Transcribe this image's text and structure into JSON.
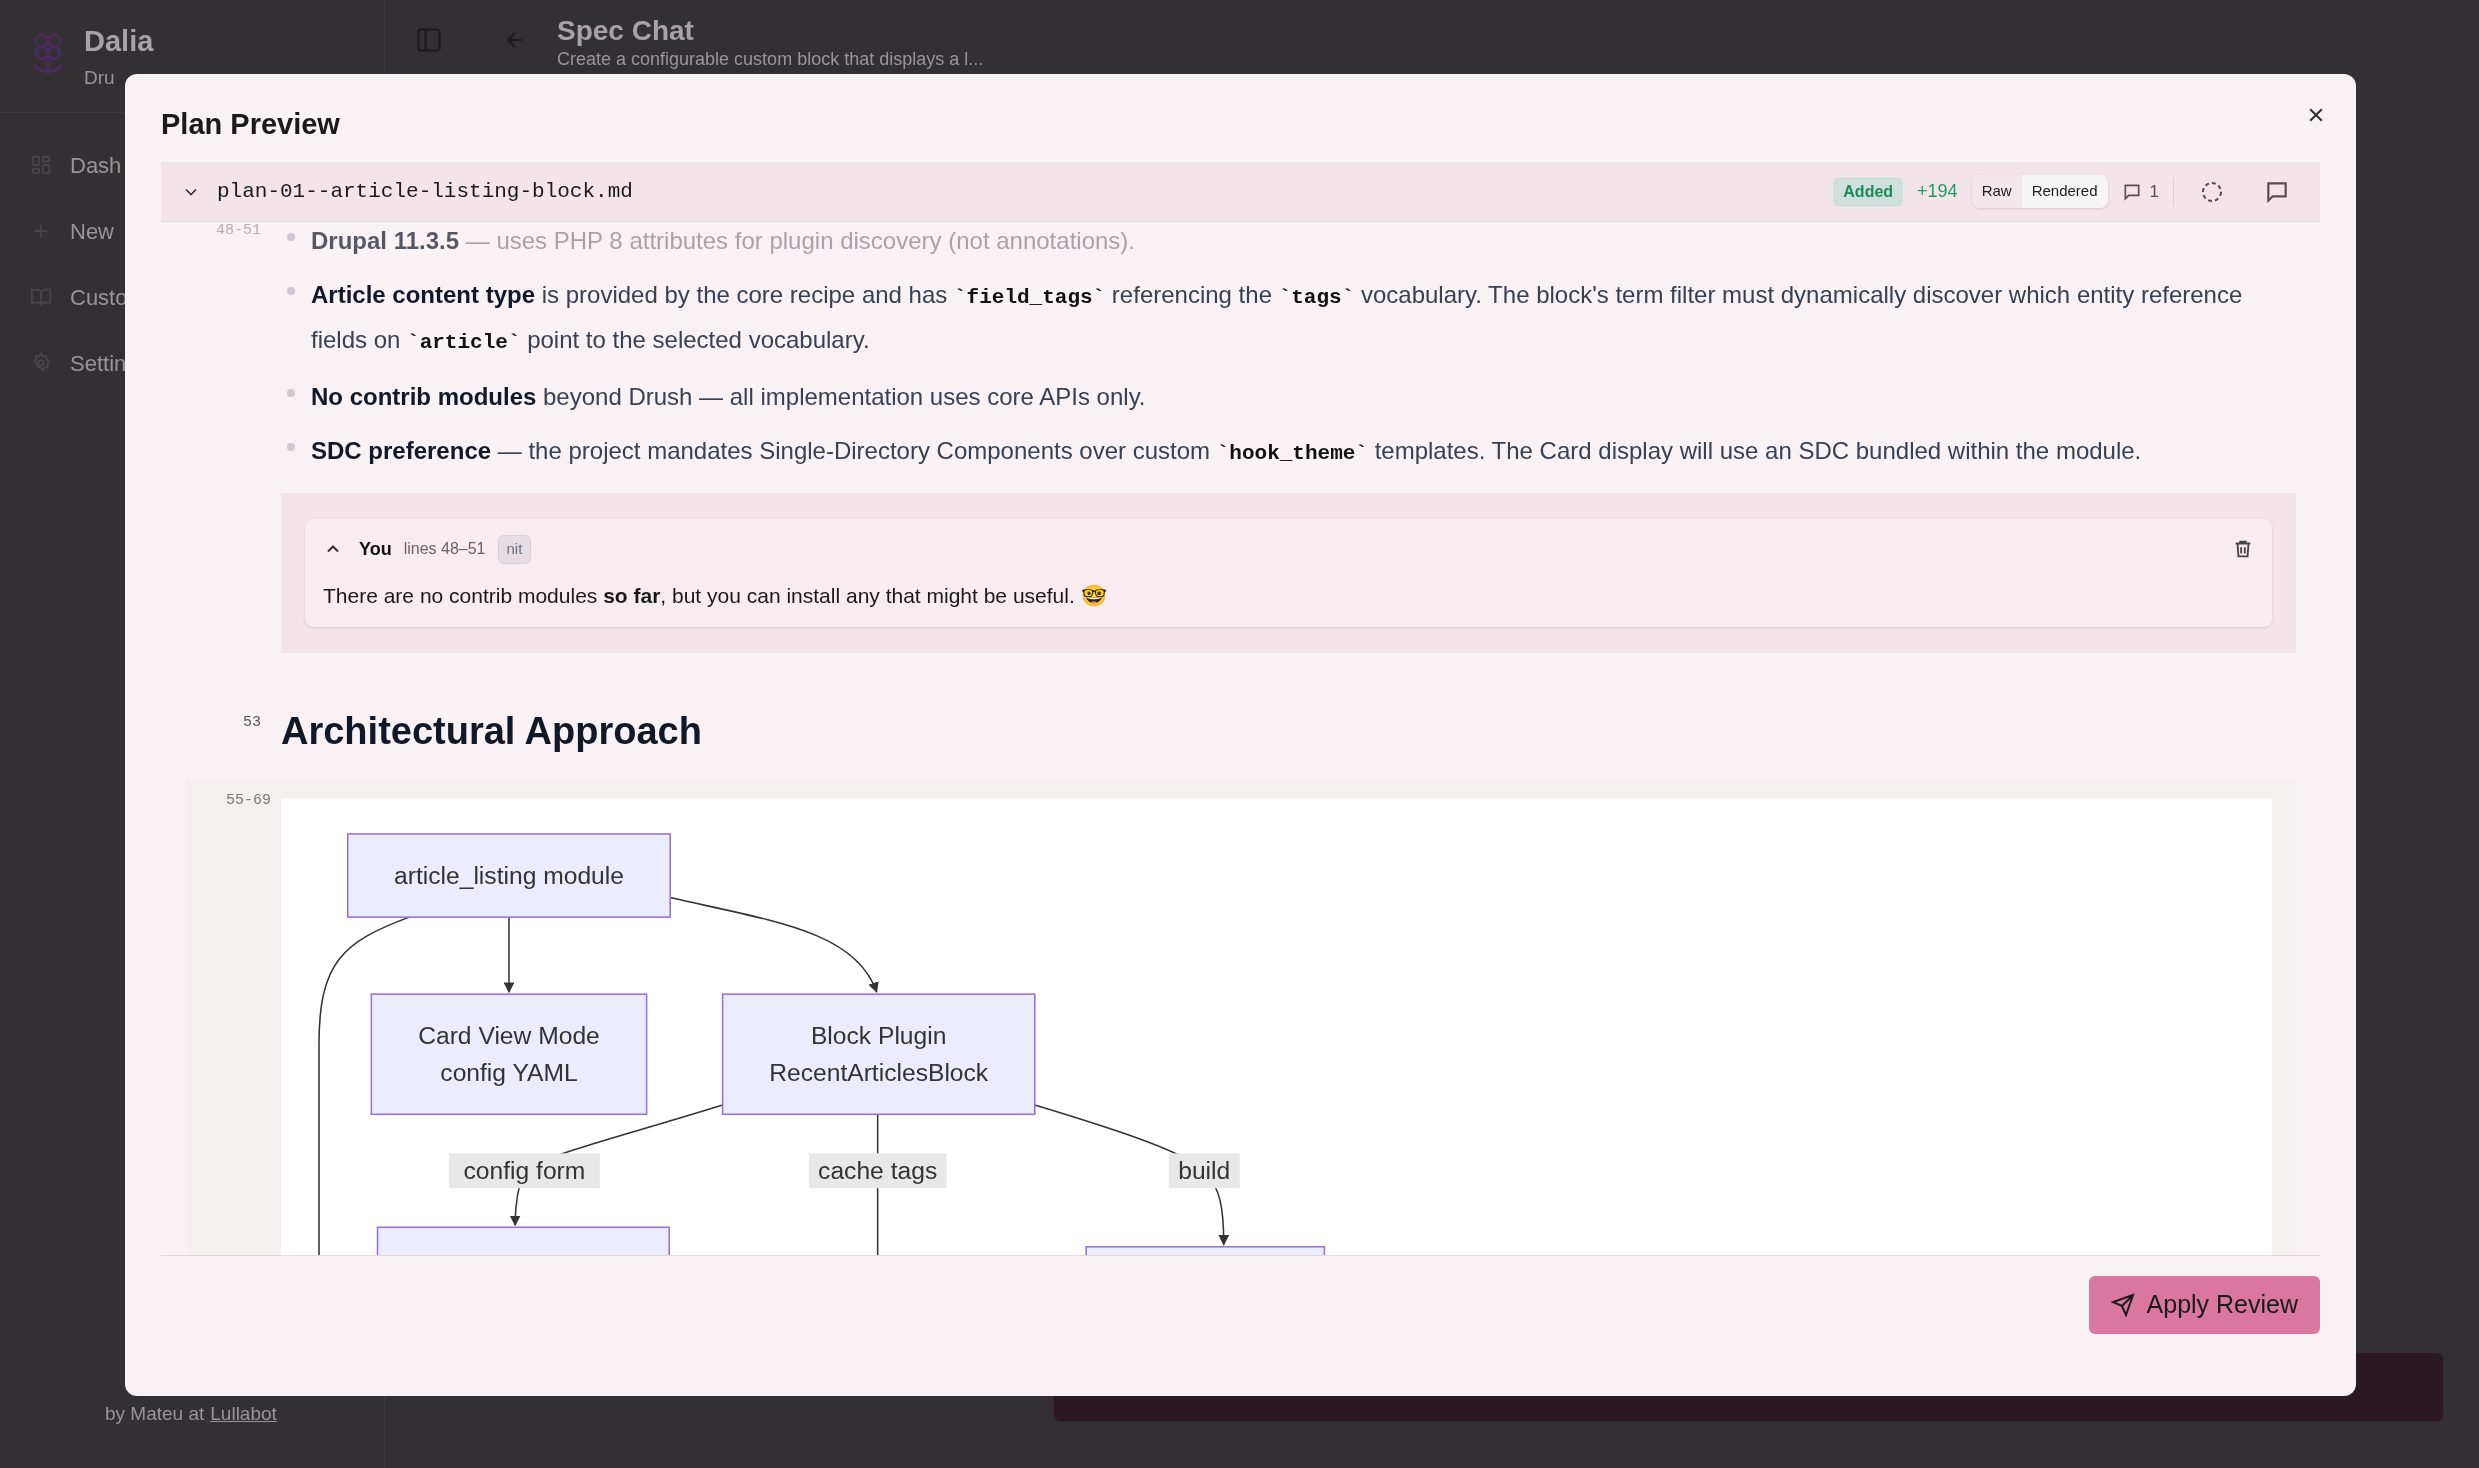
{
  "app": {
    "brand": "Dalia",
    "brand_subtitle": "Dru",
    "nav": [
      {
        "label": "Dash",
        "kind": "grid"
      },
      {
        "label": "New",
        "kind": "plus"
      },
      {
        "label": "Custo",
        "kind": "book"
      },
      {
        "label": "Settin",
        "kind": "gear"
      }
    ],
    "footer_text": "by Mateu at",
    "footer_link": "Lullabot"
  },
  "header": {
    "title": "Spec Chat",
    "subtitle": "Create a configurable custom block that displays a l..."
  },
  "modal": {
    "title": "Plan Preview",
    "file": {
      "name": "plan-01--article-listing-block.md",
      "expanded": true,
      "status": "Added",
      "additions": "+194",
      "views": [
        {
          "label": "Raw",
          "selected": false
        },
        {
          "label": "Rendered",
          "selected": true
        }
      ],
      "comment_count": "1"
    },
    "bullets": [
      {
        "line": "48-51",
        "faded": true,
        "parts": [
          {
            "t": "Drupal 11.3.5",
            "kind": "bold"
          },
          {
            "t": " — uses PHP 8 attributes for plugin discovery (not annotations).",
            "kind": "plain"
          }
        ]
      },
      {
        "faded": false,
        "parts": [
          {
            "t": "Article content type",
            "kind": "bold"
          },
          {
            "t": " is provided by the core recipe and has ",
            "kind": "plain"
          },
          {
            "t": "`field_tags`",
            "kind": "code"
          },
          {
            "t": " referencing the ",
            "kind": "plain"
          },
          {
            "t": "`tags`",
            "kind": "code"
          },
          {
            "t": " vocabulary. The block's term filter must dynamically discover which entity reference fields on ",
            "kind": "plain"
          },
          {
            "t": "`article`",
            "kind": "code"
          },
          {
            "t": " point to the selected vocabulary.",
            "kind": "plain"
          }
        ]
      },
      {
        "faded": false,
        "parts": [
          {
            "t": "No contrib modules",
            "kind": "bold"
          },
          {
            "t": " beyond Drush — all implementation uses core APIs only.",
            "kind": "plain"
          }
        ]
      },
      {
        "faded": false,
        "parts": [
          {
            "t": "SDC preference",
            "kind": "bold"
          },
          {
            "t": " — the project mandates Single-Directory Components over custom ",
            "kind": "plain"
          },
          {
            "t": "`hook_theme`",
            "kind": "code"
          },
          {
            "t": " templates. The Card display will use an SDC bundled within the module.",
            "kind": "plain"
          }
        ]
      }
    ],
    "comment": {
      "author": "You",
      "lines": "lines 48–51",
      "tag": "nit",
      "expanded": true,
      "body": "There are no contrib modules **so far**, but you can install any that might be useful. 🤓"
    },
    "heading": {
      "line": "53",
      "text": "Architectural Approach"
    },
    "diagram": {
      "lines": "55-69",
      "nodes": [
        {
          "label": "article_listing module"
        },
        {
          "label": "Card View Mode\nconfig YAML"
        },
        {
          "label": "Block Plugin\nRecentArticlesBlock"
        }
      ],
      "edge_labels": [
        "config form",
        "cache tags",
        "build"
      ]
    },
    "apply_button": "Apply Review"
  }
}
